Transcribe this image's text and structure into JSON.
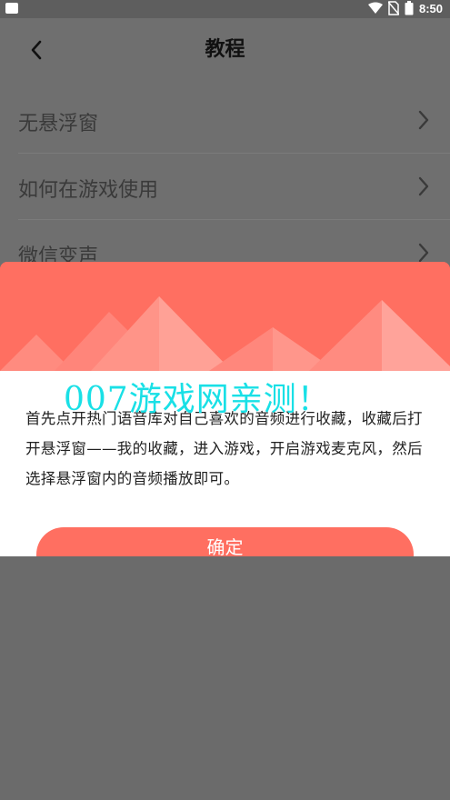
{
  "status_bar": {
    "time": "8:50",
    "icons": [
      "wifi-icon",
      "no-sim-icon",
      "battery-icon"
    ]
  },
  "app_bar": {
    "title": "教程",
    "back_icon": "chevron-left-icon"
  },
  "menu": {
    "items": [
      {
        "label": "无悬浮窗"
      },
      {
        "label": "如何在游戏使用"
      },
      {
        "label": "微信变声"
      }
    ]
  },
  "dialog": {
    "body_text": "首先点开热门语音库对自己喜欢的音频进行收藏，收藏后打开悬浮窗——我的收藏，进入游戏，开启游戏麦克风，然后选择悬浮窗内的音频播放即可。",
    "confirm_label": "确定",
    "accent_color": "#ff6f61"
  },
  "watermark": {
    "text": "007游戏网亲测！"
  }
}
